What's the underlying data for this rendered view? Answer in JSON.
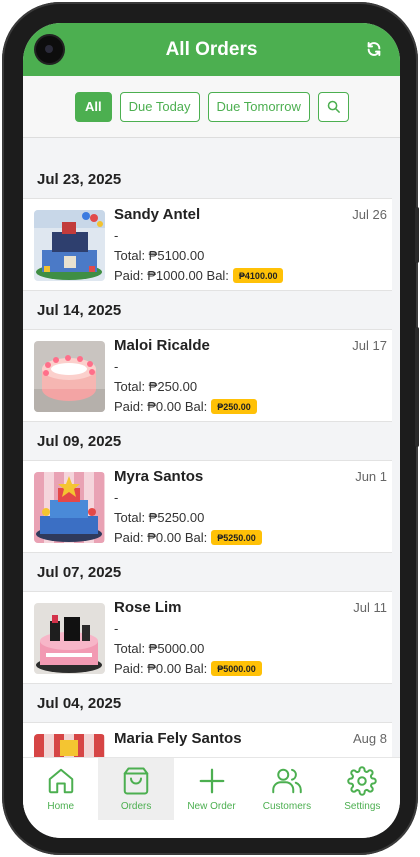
{
  "header": {
    "title": "All Orders"
  },
  "filters": {
    "all": "All",
    "due_today": "Due Today",
    "due_tomorrow": "Due Tomorrow"
  },
  "groups": [
    {
      "date": "Jul 23, 2025",
      "order": {
        "name": "Sandy Antel",
        "due": "Jul 26",
        "note": "-",
        "total": "Total: ₱5100.00",
        "paid": "Paid: ₱1000.00 Bal:",
        "balance": "₱4100.00"
      }
    },
    {
      "date": "Jul 14, 2025",
      "order": {
        "name": "Maloi Ricalde",
        "due": "Jul 17",
        "note": "-",
        "total": "Total: ₱250.00",
        "paid": "Paid: ₱0.00 Bal:",
        "balance": "₱250.00"
      }
    },
    {
      "date": "Jul 09, 2025",
      "order": {
        "name": "Myra Santos",
        "due": "Jun 1",
        "note": "-",
        "total": "Total: ₱5250.00",
        "paid": "Paid: ₱0.00 Bal:",
        "balance": "₱5250.00"
      }
    },
    {
      "date": "Jul 07, 2025",
      "order": {
        "name": "Rose Lim",
        "due": "Jul 11",
        "note": "-",
        "total": "Total: ₱5000.00",
        "paid": "Paid: ₱0.00 Bal:",
        "balance": "₱5000.00"
      }
    },
    {
      "date": "Jul 04, 2025",
      "order": {
        "name": "Maria Fely Santos",
        "due": "Aug 8"
      }
    }
  ],
  "nav": {
    "home": "Home",
    "orders": "Orders",
    "new_order": "New Order",
    "customers": "Customers",
    "settings": "Settings",
    "active": "orders"
  },
  "colors": {
    "primary": "#4caf50",
    "badge": "#ffc107"
  },
  "icons": [
    "camera-icon",
    "refresh-icon",
    "search-icon",
    "home-icon",
    "shopping-bag-icon",
    "plus-icon",
    "users-icon",
    "gear-icon"
  ]
}
